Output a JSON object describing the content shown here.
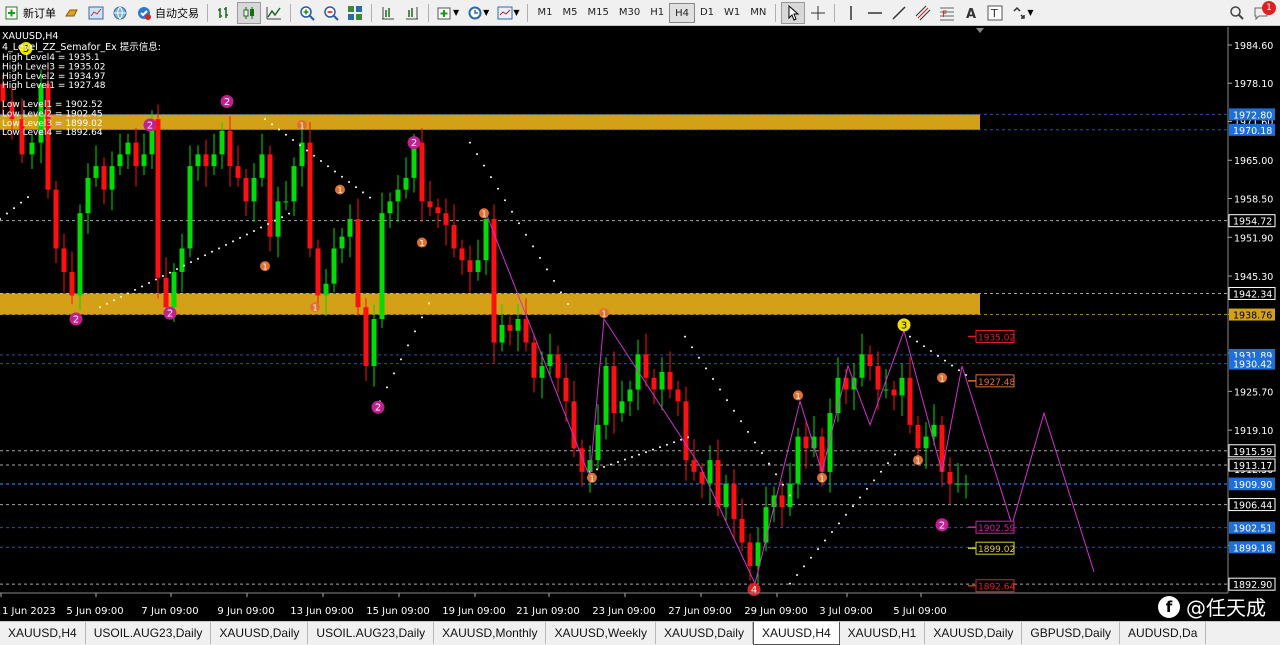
{
  "toolbar": {
    "new_order": "新订单",
    "auto_trade": "自动交易",
    "timeframes": [
      "M1",
      "M5",
      "M15",
      "M30",
      "H1",
      "H4",
      "D1",
      "W1",
      "MN"
    ],
    "active_timeframe": "H4",
    "notification_count": "1"
  },
  "chart": {
    "symbol_line": "XAUUSD,H4",
    "indicator_title": "4_Level_ZZ_Semafor_Ex 提示信息:",
    "info_lines": [
      "High Level4 = 1935.1",
      "High Level3 = 1935.02",
      "High Level2 = 1934.97",
      "High Level1 = 1927.48",
      "",
      "Low Level1 = 1902.52",
      "Low Level2 = 1902.45",
      "Low Level3 = 1899.02",
      "Low Level4 = 1892.64"
    ],
    "price_axis": [
      "1984.60",
      "1978.10",
      "1971.60",
      "1965.00",
      "1958.50",
      "1951.90",
      "1945.30",
      "1938.80",
      "1932.20",
      "1925.70",
      "1919.10",
      "1912.50",
      "1906.00",
      "1899.50",
      "1892.90"
    ],
    "price_tags": [
      {
        "text": "1972.80",
        "price": 1972.8,
        "color": "#1e6fd9"
      },
      {
        "text": "1970.18",
        "price": 1970.18,
        "color": "#1e6fd9"
      },
      {
        "text": "1954.72",
        "price": 1954.72,
        "color": "#ffffff"
      },
      {
        "text": "1942.34",
        "price": 1942.34,
        "color": "#ffffff"
      },
      {
        "text": "1938.76",
        "price": 1938.76,
        "color": "#d4a017"
      },
      {
        "text": "1931.89",
        "price": 1931.89,
        "color": "#1e6fd9"
      },
      {
        "text": "1930.42",
        "price": 1930.42,
        "color": "#1e6fd9"
      },
      {
        "text": "1915.59",
        "price": 1915.59,
        "color": "#ffffff"
      },
      {
        "text": "1913.17",
        "price": 1913.17,
        "color": "#ffffff"
      },
      {
        "text": "1910.01",
        "price": 1910.01,
        "color": "#1e6fd9"
      },
      {
        "text": "1909.90",
        "price": 1909.9,
        "color": "#1e6fd9"
      },
      {
        "text": "1906.44",
        "price": 1906.44,
        "color": "#ffffff"
      },
      {
        "text": "1902.51",
        "price": 1902.51,
        "color": "#1e6fd9"
      },
      {
        "text": "1899.18",
        "price": 1899.18,
        "color": "#1e6fd9"
      },
      {
        "text": "1892.90",
        "price": 1892.9,
        "color": "#ffffff"
      },
      {
        "text": "1984.60",
        "price": 1984.6,
        "color": "#ffffff"
      }
    ],
    "level_labels": [
      {
        "text": "1935.02",
        "price": 1935.02,
        "color": "#e02020"
      },
      {
        "text": "1927.48",
        "price": 1927.48,
        "color": "#e07030"
      },
      {
        "text": "1902.59",
        "price": 1902.59,
        "color": "#d020a0"
      },
      {
        "text": "1899.02",
        "price": 1899.02,
        "color": "#e0d020"
      },
      {
        "text": "1892.64",
        "price": 1892.64,
        "color": "#e02020"
      }
    ],
    "time_labels": [
      "1 Jun 2023",
      "5 Jun 09:00",
      "7 Jun 09:00",
      "9 Jun 09:00",
      "13 Jun 09:00",
      "15 Jun 09:00",
      "19 Jun 09:00",
      "21 Jun 09:00",
      "23 Jun 09:00",
      "27 Jun 09:00",
      "29 Jun 09:00",
      "3 Jul 09:00",
      "5 Jul 09:00"
    ],
    "zones": [
      {
        "top": 1972.8,
        "bottom": 1970.18,
        "color": "#d4a017"
      },
      {
        "top": 1942.34,
        "bottom": 1938.76,
        "color": "#d4a017"
      }
    ],
    "markers": [
      {
        "label": "3",
        "color": "#f0e000",
        "text": "#000"
      },
      {
        "label": "2",
        "color": "#c02090",
        "text": "#fff"
      },
      {
        "label": "1",
        "color": "#e07030",
        "text": "#fff"
      },
      {
        "label": "4",
        "color": "#e02020",
        "text": "#fff"
      }
    ],
    "colors": {
      "bull": "#00dd00",
      "bear": "#ff1010",
      "grid": "#505050",
      "zigzag": "#d030d0",
      "dots": "#ffffff"
    }
  },
  "tabs": [
    {
      "label": "XAUUSD,H4",
      "active": false
    },
    {
      "label": "USOIL.AUG23,Daily",
      "active": false
    },
    {
      "label": "XAUUSD,Daily",
      "active": false
    },
    {
      "label": "USOIL.AUG23,Daily",
      "active": false
    },
    {
      "label": "XAUUSD,Monthly",
      "active": false
    },
    {
      "label": "XAUUSD,Weekly",
      "active": false
    },
    {
      "label": "XAUUSD,Daily",
      "active": false
    },
    {
      "label": "XAUUSD,H4",
      "active": true
    },
    {
      "label": "XAUUSD,H1",
      "active": false
    },
    {
      "label": "XAUUSD,Daily",
      "active": false
    },
    {
      "label": "GBPUSD,Daily",
      "active": false
    },
    {
      "label": "AUDUSD,Da",
      "active": false
    }
  ],
  "watermark": {
    "text": "@任天成",
    "icon": "f"
  }
}
